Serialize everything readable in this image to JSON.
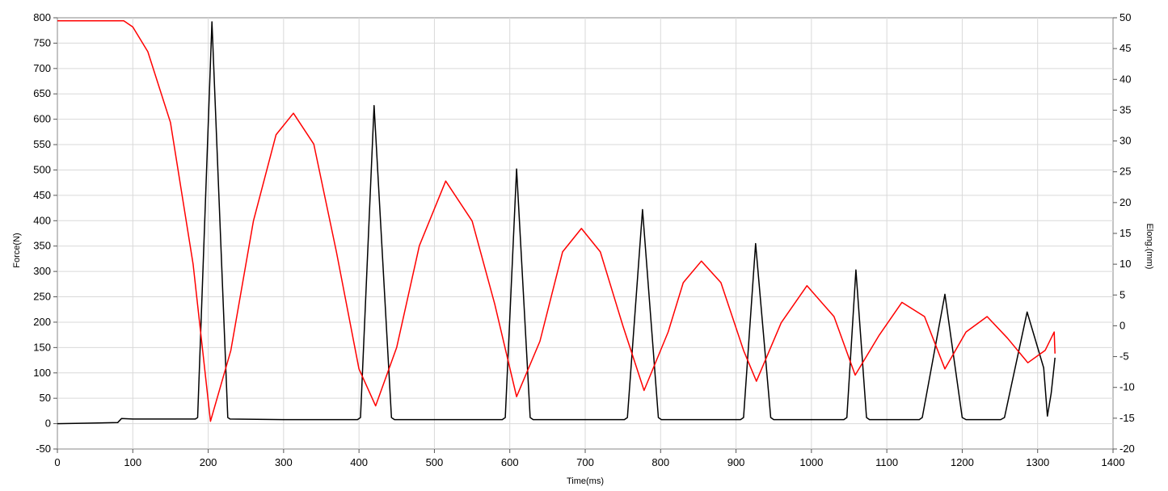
{
  "chart_data": {
    "type": "line",
    "title": "",
    "xlabel": "Time(ms)",
    "ylabel": "Force(N)",
    "y2label": "Elong.(mm)",
    "xlim": [
      0,
      1400
    ],
    "ylim": [
      -50,
      800
    ],
    "y2lim": [
      -20,
      50
    ],
    "grid": true,
    "legend": "none",
    "x_ticks": [
      0,
      100,
      200,
      300,
      400,
      500,
      600,
      700,
      800,
      900,
      1000,
      1100,
      1200,
      1300,
      1400
    ],
    "y_ticks": [
      -50,
      0,
      50,
      100,
      150,
      200,
      250,
      300,
      350,
      400,
      450,
      500,
      550,
      600,
      650,
      700,
      750,
      800
    ],
    "y2_ticks": [
      -20,
      -15,
      -10,
      -5,
      0,
      5,
      10,
      15,
      20,
      25,
      30,
      35,
      40,
      45,
      50
    ],
    "series": [
      {
        "axis": "left",
        "color": "#000000",
        "x": [
          0,
          40,
          80,
          85,
          100,
          150,
          183,
          186,
          205,
          226,
          229,
          300,
          398,
          402,
          420,
          443,
          447,
          500,
          590,
          594,
          609,
          627,
          631,
          700,
          752,
          756,
          776,
          797,
          801,
          860,
          906,
          910,
          926,
          946,
          950,
          1010,
          1043,
          1047,
          1059,
          1073,
          1077,
          1120,
          1143,
          1147,
          1177,
          1200,
          1205,
          1230,
          1251,
          1256,
          1286,
          1308,
          1313,
          1318,
          1323
        ],
        "values": [
          0,
          1,
          2,
          10,
          9,
          9,
          9,
          12,
          792,
          12,
          9,
          8,
          8,
          12,
          627,
          12,
          8,
          8,
          8,
          12,
          502,
          12,
          8,
          8,
          8,
          12,
          422,
          12,
          8,
          8,
          8,
          12,
          355,
          12,
          8,
          8,
          8,
          12,
          303,
          12,
          8,
          8,
          8,
          12,
          255,
          12,
          8,
          8,
          8,
          12,
          220,
          110,
          15,
          60,
          130
        ]
      },
      {
        "axis": "right",
        "color": "#ff0000",
        "x": [
          0,
          50,
          88,
          100,
          120,
          150,
          180,
          203,
          230,
          260,
          290,
          313,
          340,
          370,
          400,
          422,
          450,
          480,
          515,
          550,
          580,
          609,
          640,
          670,
          695,
          720,
          750,
          778,
          810,
          830,
          854,
          880,
          910,
          927,
          960,
          994,
          1030,
          1058,
          1090,
          1120,
          1150,
          1177,
          1205,
          1233,
          1260,
          1287,
          1310,
          1322,
          1323
        ],
        "values": [
          49.5,
          49.5,
          49.5,
          48.5,
          44.5,
          33.0,
          10.0,
          -15.5,
          -4.0,
          17.0,
          31.0,
          34.5,
          29.5,
          12.0,
          -7.0,
          -13.0,
          -3.5,
          13.0,
          23.5,
          17.0,
          3.5,
          -11.5,
          -2.5,
          12.0,
          15.8,
          12.0,
          0.0,
          -10.5,
          -1.0,
          7.0,
          10.5,
          7.0,
          -4.0,
          -9.0,
          0.5,
          6.5,
          1.5,
          -8.0,
          -1.5,
          3.8,
          1.5,
          -7.0,
          -1.0,
          1.5,
          -2.0,
          -6.0,
          -4.0,
          -1.0,
          -4.5
        ]
      }
    ]
  }
}
